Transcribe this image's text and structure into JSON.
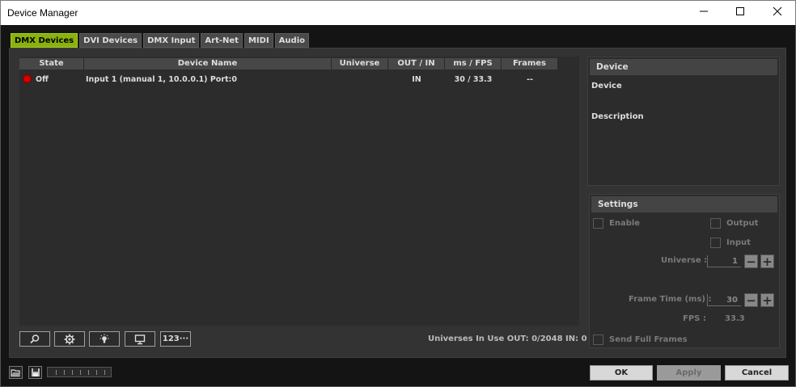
{
  "window": {
    "title": "Device Manager",
    "minimize_glyph": "—",
    "maximize_glyph": "☐",
    "close_glyph": "✕"
  },
  "tabs": [
    {
      "label": "DMX Devices",
      "active": true
    },
    {
      "label": "DVI Devices",
      "active": false
    },
    {
      "label": "DMX Input",
      "active": false
    },
    {
      "label": "Art-Net",
      "active": false
    },
    {
      "label": "MIDI",
      "active": false
    },
    {
      "label": "Audio",
      "active": false
    }
  ],
  "table": {
    "columns": [
      "State",
      "Device Name",
      "Universe",
      "OUT / IN",
      "ms / FPS",
      "Frames"
    ],
    "rows": [
      {
        "state": "Off",
        "state_color": "#d20000",
        "device_name": "Input 1 (manual 1, 10.0.0.1) Port:0",
        "universe": "",
        "out_in": "IN",
        "ms_fps": "30 / 33.3",
        "frames": "--"
      }
    ]
  },
  "toolbar": {
    "buttons": [
      {
        "icon": "search-icon",
        "label": ""
      },
      {
        "icon": "gear-icon",
        "label": ""
      },
      {
        "icon": "lightbulb-icon",
        "label": ""
      },
      {
        "icon": "monitor-icon",
        "label": ""
      },
      {
        "icon": "numbering-icon",
        "label": "123···"
      }
    ],
    "status": "Universes In Use OUT: 0/2048  IN: 0"
  },
  "device_panel": {
    "header": "Device",
    "device_label": "Device",
    "description_label": "Description"
  },
  "settings": {
    "header": "Settings",
    "enable_label": "Enable",
    "output_label": "Output",
    "input_label": "Input",
    "universe_label": "Universe :",
    "universe_value": "1",
    "frame_time_label": "Frame Time (ms) :",
    "frame_time_value": "30",
    "fps_label": "FPS :",
    "fps_value": "33.3",
    "send_full_frames_label": "Send Full Frames"
  },
  "footer": {
    "open_icon": "folder-open-icon",
    "save_icon": "save-icon",
    "ok_label": "OK",
    "apply_label": "Apply",
    "cancel_label": "Cancel"
  },
  "colors": {
    "active_tab": "#8ab10f",
    "background": "#141414",
    "panel": "#2c2c2c"
  }
}
